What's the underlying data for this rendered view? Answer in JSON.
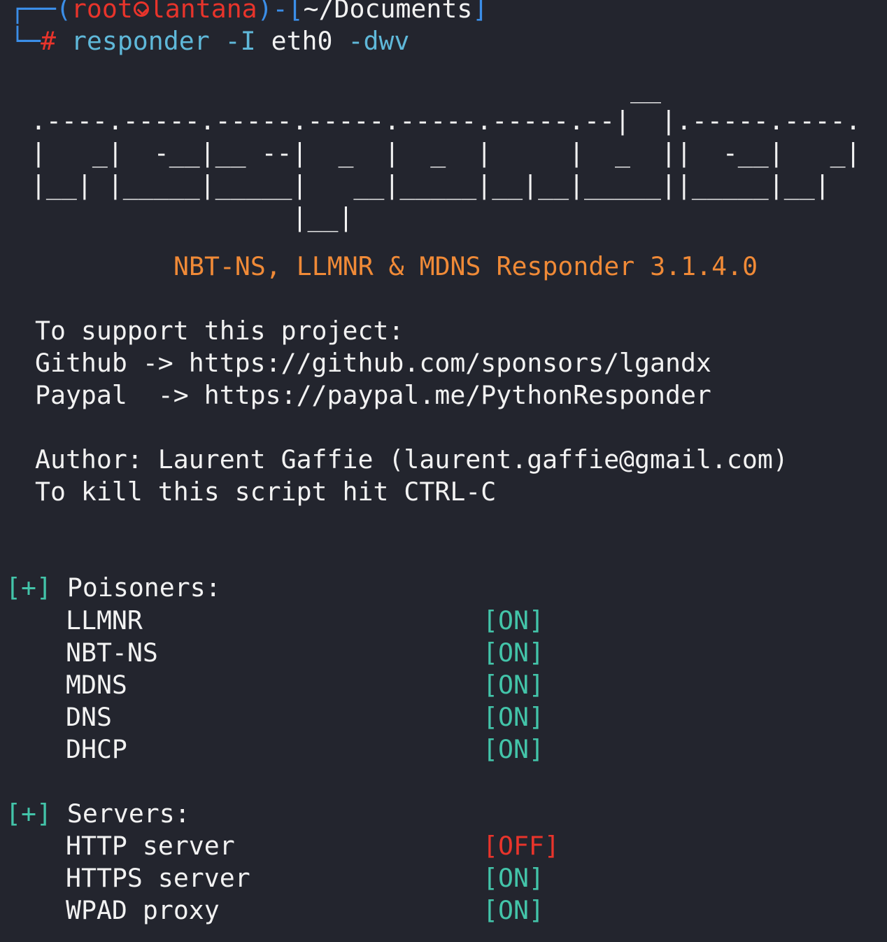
{
  "prompt": {
    "corner_top": "┌──",
    "corner_bottom": "└─",
    "open_paren": "(",
    "user": "root",
    "host": "lantana",
    "close_paren": ")",
    "separator": "-",
    "open_bracket": "[",
    "cwd": "~/Documents",
    "close_bracket": "]",
    "symbol": "# ",
    "command": "responder",
    "arg1": " -I",
    "arg2": " eth0",
    "arg3": " -dwv"
  },
  "banner": {
    "ascii_art": "                                         __\n  .----.-----.-----.-----.-----.-----.--|  |.-----.----.\n  |   _|  -__|__ --|  _  |  _  |     |  _  ||  -__|   _|\n  |__| |_____|_____|   __|_____|__|__|_____||_____|__|\n                   |__|",
    "version_line": "NBT-NS, LLMNR & MDNS Responder 3.1.4.0"
  },
  "info": {
    "support": "To support this project:",
    "github": "Github -> https://github.com/sponsors/lgandx",
    "paypal": "Paypal  -> https://paypal.me/PythonResponder",
    "author": "Author: Laurent Gaffie (laurent.gaffie@gmail.com)",
    "kill": "To kill this script hit CTRL-C"
  },
  "sections": {
    "marker": "[+]",
    "poisoners_title": "Poisoners:",
    "poisoners": [
      {
        "name": "LLMNR",
        "status": "[ON]"
      },
      {
        "name": "NBT-NS",
        "status": "[ON]"
      },
      {
        "name": "MDNS",
        "status": "[ON]"
      },
      {
        "name": "DNS",
        "status": "[ON]"
      },
      {
        "name": "DHCP",
        "status": "[ON]"
      }
    ],
    "servers_title": "Servers:",
    "servers": [
      {
        "name": "HTTP server",
        "status": "[OFF]"
      },
      {
        "name": "HTTPS server",
        "status": "[ON]"
      },
      {
        "name": "WPAD proxy",
        "status": "[ON]"
      }
    ]
  },
  "colors": {
    "background": "#23252e",
    "prompt_blue": "#3b8ee8",
    "prompt_red": "#e8342b",
    "status_on": "#43c4a9",
    "status_off": "#e8342b",
    "banner_orange": "#f08a37"
  }
}
